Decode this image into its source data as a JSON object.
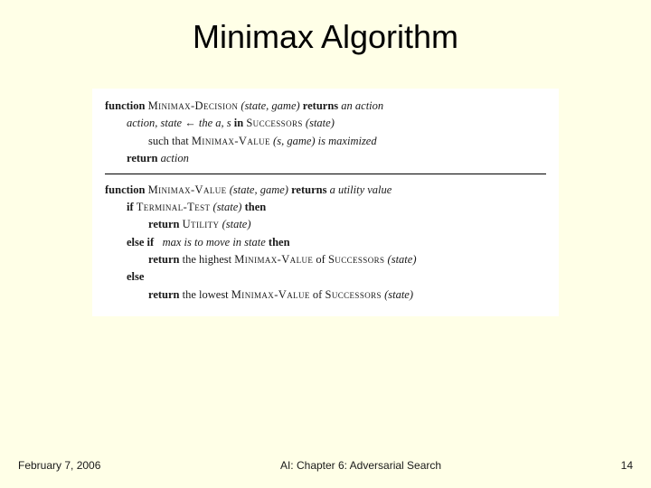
{
  "slide": {
    "title": "Minimax Algorithm"
  },
  "kw": {
    "function": "function",
    "returns": "returns",
    "if": "if",
    "then": "then",
    "else_if": "else if",
    "else": "else",
    "return": "return"
  },
  "fn": {
    "minimax_decision": "Minimax-Decision",
    "minimax_value": "Minimax-Value",
    "successors": "Successors",
    "terminal_test": "Terminal-Test",
    "utility": "Utility"
  },
  "txt": {
    "args_sg": "(state, game)",
    "ret_action": "an action",
    "line1a": "action, state ← the a, s ",
    "line1b": "in",
    "line1c": " ",
    "succ_state": "(state)",
    "line2a": "such that ",
    "line2b": "(s, game) is maximized",
    "return_action": "action",
    "ret_utility": "a utility value",
    "tt_arg": "(state)",
    "util_arg": "(state)",
    "max_move": "max is to move in state ",
    "highest": "the highest ",
    "of": " of ",
    "lowest": "the lowest "
  },
  "footer": {
    "date": "February 7, 2006",
    "center": "AI: Chapter 6: Adversarial Search",
    "page": "14"
  }
}
